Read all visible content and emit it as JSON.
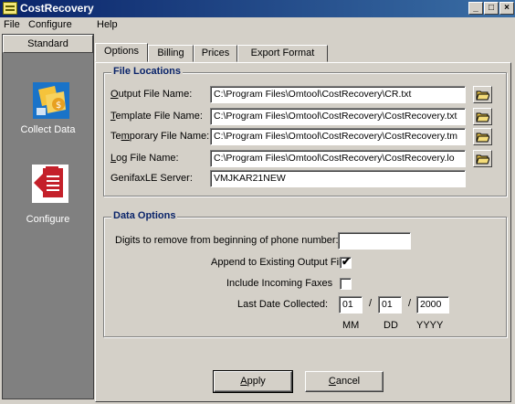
{
  "window": {
    "title": "CostRecovery",
    "min": "_",
    "max": "□",
    "close": "×"
  },
  "menu": [
    {
      "label": "File"
    },
    {
      "label": "Configure"
    },
    {
      "label": "Help"
    }
  ],
  "sidebar": {
    "header": "Standard",
    "items": [
      {
        "label": "Collect Data",
        "icon": "collect-data-icon"
      },
      {
        "label": "Configure",
        "icon": "configure-icon"
      }
    ]
  },
  "tabs": [
    "Options",
    "Billing",
    "Prices",
    "Export Format"
  ],
  "file_locations": {
    "title": "File Locations",
    "output": {
      "label_u": "O",
      "label_rest": "utput File Name:",
      "value": "C:\\Program Files\\Omtool\\CostRecovery\\CR.txt"
    },
    "template": {
      "label_u": "T",
      "label_rest": "emplate File Name:",
      "value": "C:\\Program Files\\Omtool\\CostRecovery\\CostRecovery.txt"
    },
    "temporary": {
      "label_pre": "Te",
      "label_u": "m",
      "label_rest": "porary File Name:",
      "value": "C:\\Program Files\\Omtool\\CostRecovery\\CostRecovery.tm"
    },
    "log": {
      "label_u": "L",
      "label_rest": "og File Name:",
      "value": "C:\\Program Files\\Omtool\\CostRecovery\\CostRecovery.lo"
    },
    "server": {
      "label": "GenifaxLE Server:",
      "value": "VMJKAR21NEW"
    }
  },
  "data_options": {
    "title": "Data Options",
    "digits_label": "Digits to remove from beginning of phone number:",
    "digits_value": "",
    "append_label": "Append to Existing Output File",
    "append_checked": "✔",
    "incoming_label": "Include Incoming Faxes",
    "incoming_checked": "",
    "last_date_label": "Last Date Collected:",
    "month": "01",
    "day": "01",
    "year": "2000",
    "sep": "/",
    "mm": "MM",
    "dd": "DD",
    "yyyy": "YYYY"
  },
  "buttons": {
    "apply_u": "A",
    "apply_rest": "pply",
    "cancel_u": "C",
    "cancel_rest": "ancel"
  }
}
